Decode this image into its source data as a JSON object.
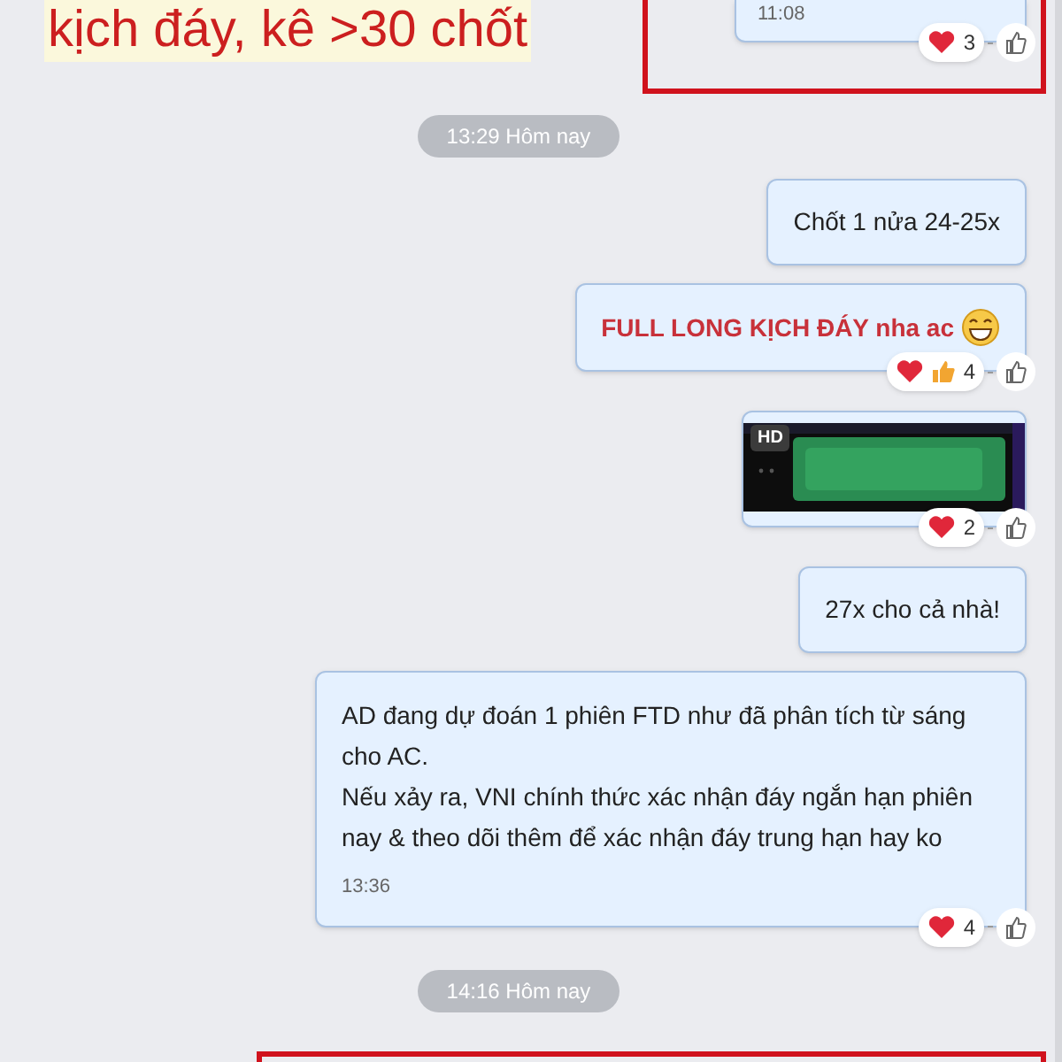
{
  "note": {
    "text": "kịch đáy, kê >30 chốt"
  },
  "messages": [
    {
      "kind": "highlighted",
      "time": "11:08",
      "reactions": {
        "heart": true,
        "thumb": false,
        "count": "3"
      }
    },
    {
      "kind": "date",
      "text": "13:29 Hôm nay"
    },
    {
      "kind": "text",
      "text": "Chốt 1 nửa 24-25x"
    },
    {
      "kind": "text",
      "text": "FULL LONG KỊCH ĐÁY nha ac",
      "emphasis": true,
      "emoji": true,
      "reactions": {
        "heart": true,
        "thumb": true,
        "count": "4"
      }
    },
    {
      "badge": "HD",
      "reactions": {
        "heart": true,
        "thumb": false,
        "count": "2"
      }
    },
    {
      "kind": "text",
      "text": "27x cho cả nhà!"
    },
    {
      "kind": "text",
      "lines": [
        "AD đang dự đoán 1 phiên FTD như đã phân tích từ sáng cho AC.",
        "Nếu xảy ra, VNI chính thức xác nhận đáy ngắn hạn phiên nay & theo dõi thêm để xác nhận đáy trung hạn hay ko"
      ],
      "time": "13:36",
      "reactions": {
        "heart": true,
        "thumb": false,
        "count": "4"
      }
    },
    {
      "kind": "date",
      "text": "14:16 Hôm nay"
    },
    {
      "kind": "highlighted_start"
    }
  ]
}
